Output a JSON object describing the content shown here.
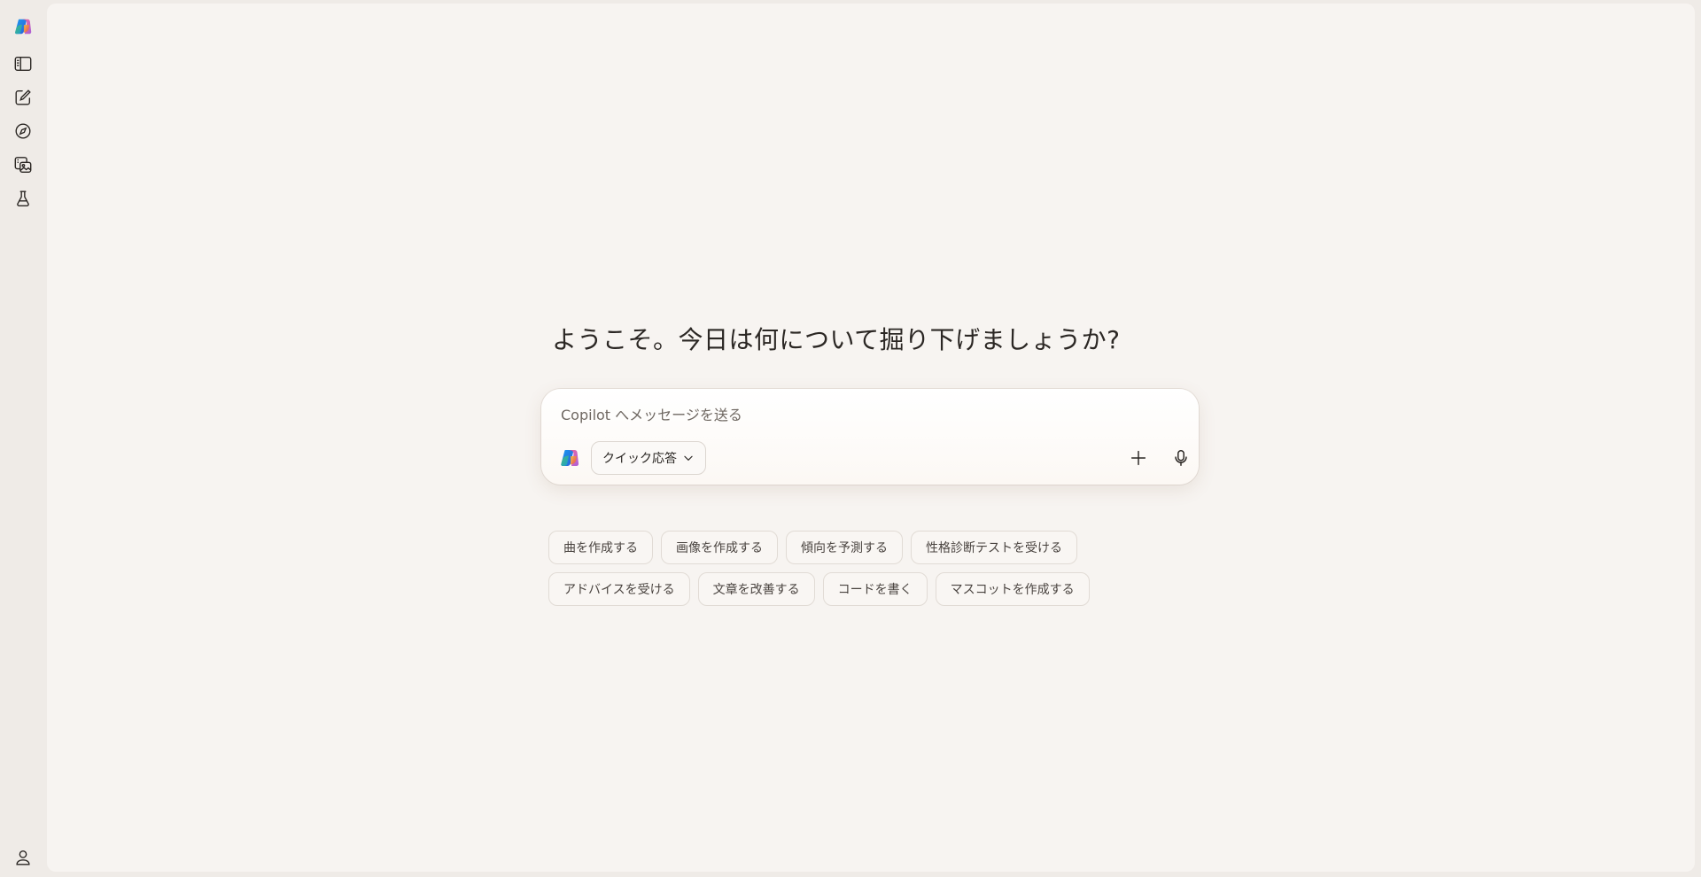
{
  "sidebar": {
    "items": [
      {
        "icon": "copilot-logo-icon",
        "name": "copilot-home"
      },
      {
        "icon": "sidebar-panel-icon",
        "name": "toggle-sidebar"
      },
      {
        "icon": "new-chat-icon",
        "name": "new-chat"
      },
      {
        "icon": "discover-compass-icon",
        "name": "discover"
      },
      {
        "icon": "image-gallery-icon",
        "name": "images"
      },
      {
        "icon": "labs-flask-icon",
        "name": "labs"
      }
    ],
    "profile_icon": "user-profile-icon"
  },
  "main": {
    "headline": "ようこそ。今日は何について掘り下げましょうか?",
    "composer": {
      "placeholder": "Copilot へメッセージを送る",
      "mode_label": "クイック応答",
      "add_icon": "plus-icon",
      "mic_icon": "microphone-icon"
    },
    "suggestions": {
      "row1": [
        "曲を作成する",
        "画像を作成する",
        "傾向を予測する",
        "性格診断テストを受ける"
      ],
      "row2": [
        "アドバイスを受ける",
        "文章を改善する",
        "コードを書く",
        "マスコットを作成する"
      ]
    }
  },
  "colors": {
    "background": "#efebe7",
    "canvas": "#f7f4f1",
    "text": "#2a2623",
    "chip_border": "#e1dbd5"
  }
}
